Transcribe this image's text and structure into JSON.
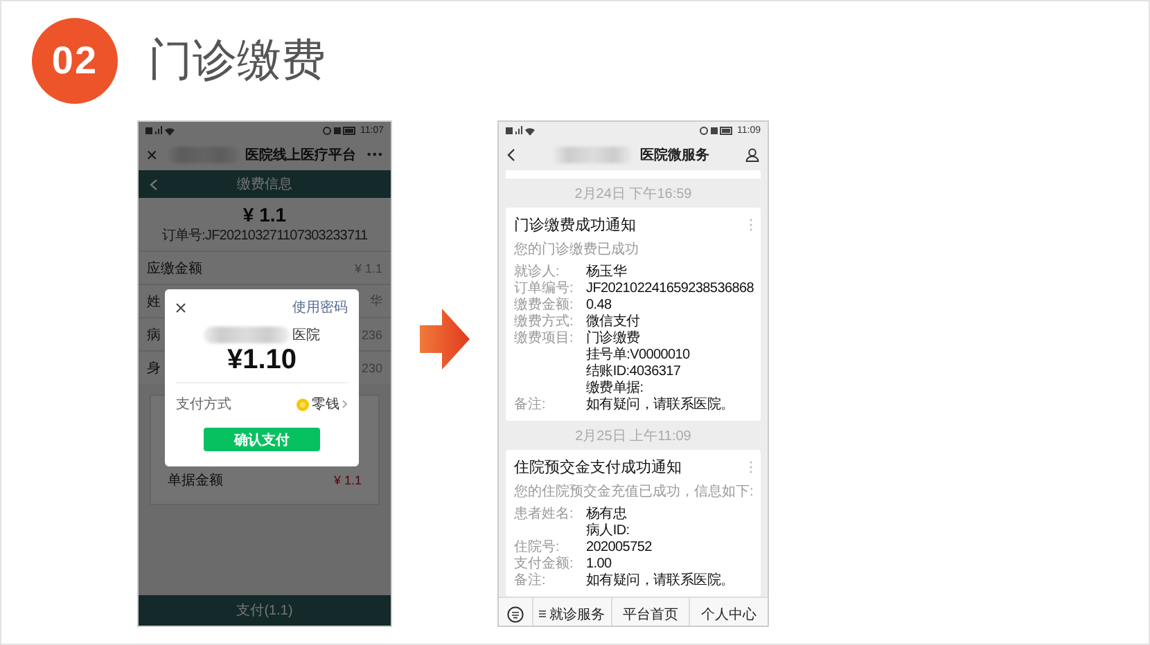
{
  "slide": {
    "number": "02",
    "title": "门诊缴费"
  },
  "payment_phone": {
    "status_time": "11:07",
    "nav_title": "医院线上医疗平台",
    "header_title": "缴费信息",
    "amount": "¥ 1.1",
    "order_no": "订单号:JF202103271107303233711",
    "rows": [
      {
        "label": "应缴金额",
        "value": "¥ 1.1"
      },
      {
        "label": "姓",
        "value": "华"
      },
      {
        "label": "病",
        "value": "236"
      },
      {
        "label": "身",
        "value": "230"
      }
    ],
    "card_rows": [
      {
        "label": "单据金额",
        "value": "¥ 1.1"
      }
    ],
    "pay_button": "支付(1.1)",
    "dialog": {
      "password_link": "使用密码",
      "payee": "医院",
      "amount": "¥1.10",
      "method_label": "支付方式",
      "method_value": "零钱",
      "confirm_button": "确认支付"
    }
  },
  "notice_phone": {
    "status_time": "11:09",
    "nav_title": "医院微服务",
    "messages": [
      {
        "time": "2月24日 下午16:59",
        "title": "门诊缴费成功通知",
        "subtitle": "您的门诊缴费已成功",
        "fields": [
          {
            "label": "就诊人:",
            "lines": [
              "杨玉华"
            ]
          },
          {
            "label": "订单编号:",
            "lines": [
              "JF202102241659238536868"
            ]
          },
          {
            "label": "缴费金额:",
            "lines": [
              "0.48"
            ]
          },
          {
            "label": "缴费方式:",
            "lines": [
              "微信支付"
            ]
          },
          {
            "label": "缴费项目:",
            "lines": [
              "门诊缴费",
              "挂号单:V0000010",
              "结账ID:4036317",
              "缴费单据:"
            ]
          },
          {
            "label": "备注:",
            "lines": [
              "如有疑问，请联系医院。"
            ]
          }
        ]
      },
      {
        "time": "2月25日 上午11:09",
        "title": "住院预交金支付成功通知",
        "subtitle": "您的住院预交金充值已成功，信息如下:",
        "fields": [
          {
            "label": "患者姓名:",
            "lines": [
              "杨有忠",
              "病人ID:"
            ]
          },
          {
            "label": "住院号:",
            "lines": [
              "202005752"
            ]
          },
          {
            "label": "支付金额:",
            "lines": [
              "1.00"
            ]
          },
          {
            "label": "备注:",
            "lines": [
              "如有疑问，请联系医院。"
            ]
          }
        ]
      }
    ],
    "bottom_nav": [
      "就诊服务",
      "平台首页",
      "个人中心"
    ]
  }
}
